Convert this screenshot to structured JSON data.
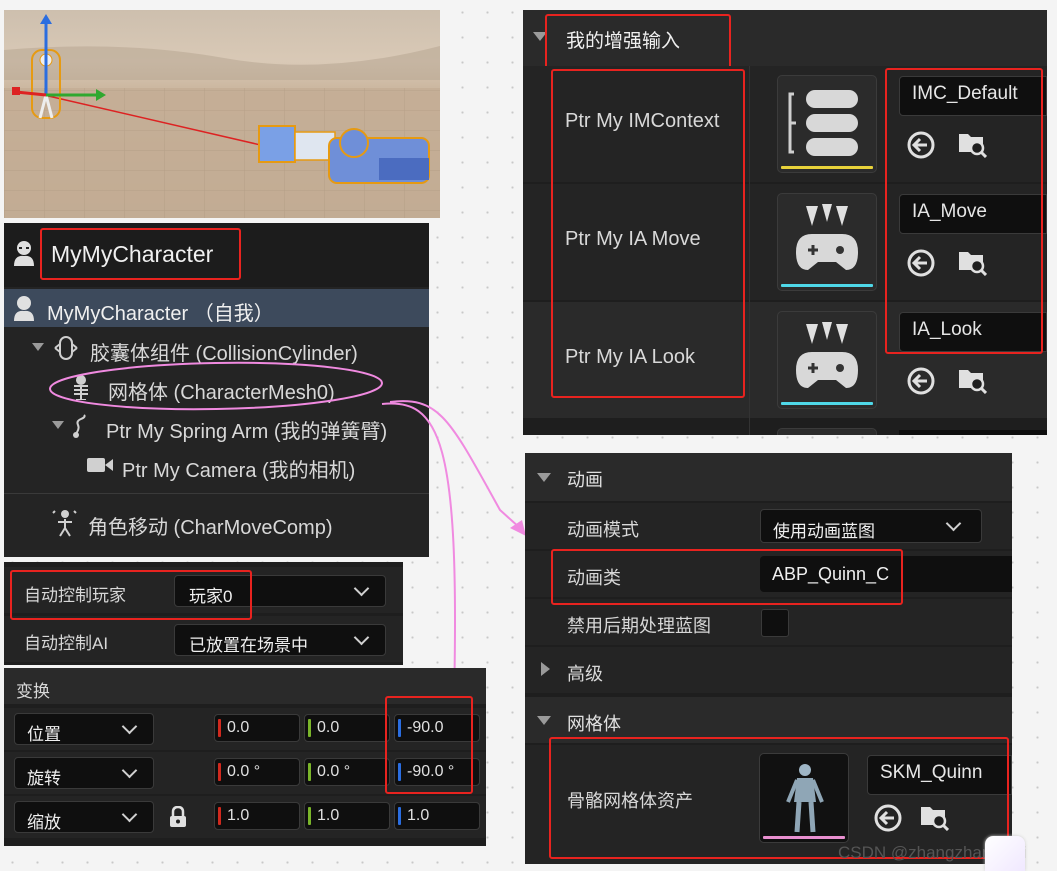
{
  "viewport": {
    "alt": ""
  },
  "components": {
    "header_title": "MyMyCharacter",
    "root_item": "MyMyCharacter （自我）",
    "items": [
      "胶囊体组件 (CollisionCylinder)",
      "网格体 (CharacterMesh0)",
      "Ptr My Spring Arm (我的弹簧臂)",
      "Ptr My Camera (我的相机)",
      "角色移动 (CharMoveComp)"
    ]
  },
  "auto_control": {
    "player_label": "自动控制玩家",
    "player_value": "玩家0",
    "ai_label": "自动控制AI",
    "ai_value": "已放置在场景中"
  },
  "transform": {
    "section_title": "变换",
    "rows": [
      {
        "label": "位置",
        "x": "0.0",
        "y": "0.0",
        "z": "-90.0"
      },
      {
        "label": "旋转",
        "x": "0.0 °",
        "y": "0.0 °",
        "z": "-90.0 °"
      },
      {
        "label": "缩放",
        "x": "1.0",
        "y": "1.0",
        "z": "1.0"
      }
    ]
  },
  "enhanced_input": {
    "section_title": "我的增强输入",
    "rows": [
      {
        "label": "Ptr My IMContext",
        "asset": "IMC_Default",
        "underline": "#e8d23a"
      },
      {
        "label": "Ptr My IA Move",
        "asset": "IA_Move",
        "underline": "#4fd8e8"
      },
      {
        "label": "Ptr My IA Look",
        "asset": "IA_Look",
        "underline": "#4fd8e8"
      }
    ]
  },
  "animation": {
    "section_title": "动画",
    "mode_label": "动画模式",
    "mode_value": "使用动画蓝图",
    "class_label": "动画类",
    "class_value": "ABP_Quinn_C",
    "disable_post_label": "禁用后期处理蓝图",
    "advanced_label": "高级",
    "mesh_section_title": "网格体",
    "skeletal_label": "骨骼网格体资产",
    "skeletal_value": "SKM_Quinn",
    "skeletal_underline": "#e88fd0"
  },
  "watermark": "CSDN @zhangzhangkeji",
  "colors": {
    "highlight_red": "#e8231f",
    "annotation_pink": "#f08ae0",
    "selected_row": "#3d4a5c"
  }
}
